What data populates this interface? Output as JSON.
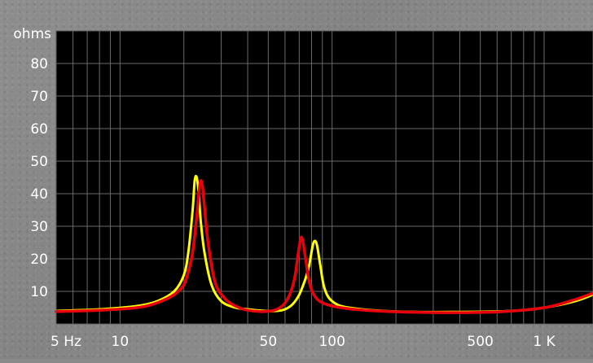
{
  "chart_data": {
    "type": "line",
    "ylabel": "ohms",
    "y_ticks": [
      "10",
      "20",
      "30",
      "40",
      "50",
      "60",
      "70",
      "80"
    ],
    "ylim": [
      0,
      90
    ],
    "x_scale": "log",
    "xlim": [
      5,
      1700
    ],
    "x_tick_labels": [
      {
        "value": 5,
        "label": "5 Hz"
      },
      {
        "value": 10,
        "label": "10"
      },
      {
        "value": 50,
        "label": "50"
      },
      {
        "value": 100,
        "label": "100"
      },
      {
        "value": 500,
        "label": "500"
      },
      {
        "value": 1000,
        "label": "1 K"
      }
    ],
    "x_gridlines": [
      6,
      7,
      8,
      9,
      10,
      20,
      30,
      40,
      50,
      60,
      70,
      80,
      90,
      100,
      200,
      300,
      400,
      500,
      600,
      700,
      800,
      900,
      1000
    ],
    "y_gridlines": [
      10,
      20,
      30,
      40,
      50,
      60,
      70,
      80
    ],
    "grid": true,
    "background": "#000000",
    "series": [
      {
        "color": "#ffff00",
        "points": [
          [
            5,
            4
          ],
          [
            8,
            4.5
          ],
          [
            12,
            5.5
          ],
          [
            15,
            7
          ],
          [
            18,
            10
          ],
          [
            20,
            15
          ],
          [
            21,
            22
          ],
          [
            22,
            35
          ],
          [
            22.5,
            44
          ],
          [
            23,
            45
          ],
          [
            23.5,
            40
          ],
          [
            24,
            32
          ],
          [
            25,
            22
          ],
          [
            27,
            12
          ],
          [
            30,
            7
          ],
          [
            35,
            5
          ],
          [
            40,
            4.5
          ],
          [
            48,
            4
          ],
          [
            55,
            4
          ],
          [
            60,
            4.5
          ],
          [
            65,
            6
          ],
          [
            70,
            9
          ],
          [
            75,
            14
          ],
          [
            78,
            18
          ],
          [
            81,
            24
          ],
          [
            83,
            25.5
          ],
          [
            85,
            24
          ],
          [
            88,
            18
          ],
          [
            92,
            11
          ],
          [
            100,
            7
          ],
          [
            120,
            5
          ],
          [
            200,
            3.8
          ],
          [
            400,
            3.7
          ],
          [
            700,
            4
          ],
          [
            1000,
            5
          ],
          [
            1400,
            7
          ],
          [
            1700,
            9
          ]
        ]
      },
      {
        "color": "#e8000d",
        "points": [
          [
            5,
            3.8
          ],
          [
            8,
            4.2
          ],
          [
            12,
            5
          ],
          [
            15,
            6.5
          ],
          [
            18,
            9
          ],
          [
            20,
            12
          ],
          [
            21,
            16
          ],
          [
            22,
            22
          ],
          [
            23,
            33
          ],
          [
            23.5,
            40
          ],
          [
            24,
            44
          ],
          [
            24.5,
            42
          ],
          [
            25,
            36
          ],
          [
            26,
            25
          ],
          [
            28,
            13
          ],
          [
            31,
            8
          ],
          [
            35,
            5.5
          ],
          [
            40,
            4.2
          ],
          [
            48,
            3.8
          ],
          [
            55,
            4.5
          ],
          [
            60,
            6.5
          ],
          [
            64,
            10
          ],
          [
            67,
            15
          ],
          [
            69,
            21
          ],
          [
            71,
            26
          ],
          [
            72,
            26.5
          ],
          [
            73,
            25
          ],
          [
            75,
            20
          ],
          [
            78,
            13
          ],
          [
            82,
            9
          ],
          [
            90,
            6.5
          ],
          [
            110,
            5
          ],
          [
            160,
            4
          ],
          [
            300,
            3.5
          ],
          [
            600,
            3.7
          ],
          [
            1000,
            5
          ],
          [
            1400,
            7.5
          ],
          [
            1700,
            9.5
          ]
        ]
      }
    ]
  }
}
